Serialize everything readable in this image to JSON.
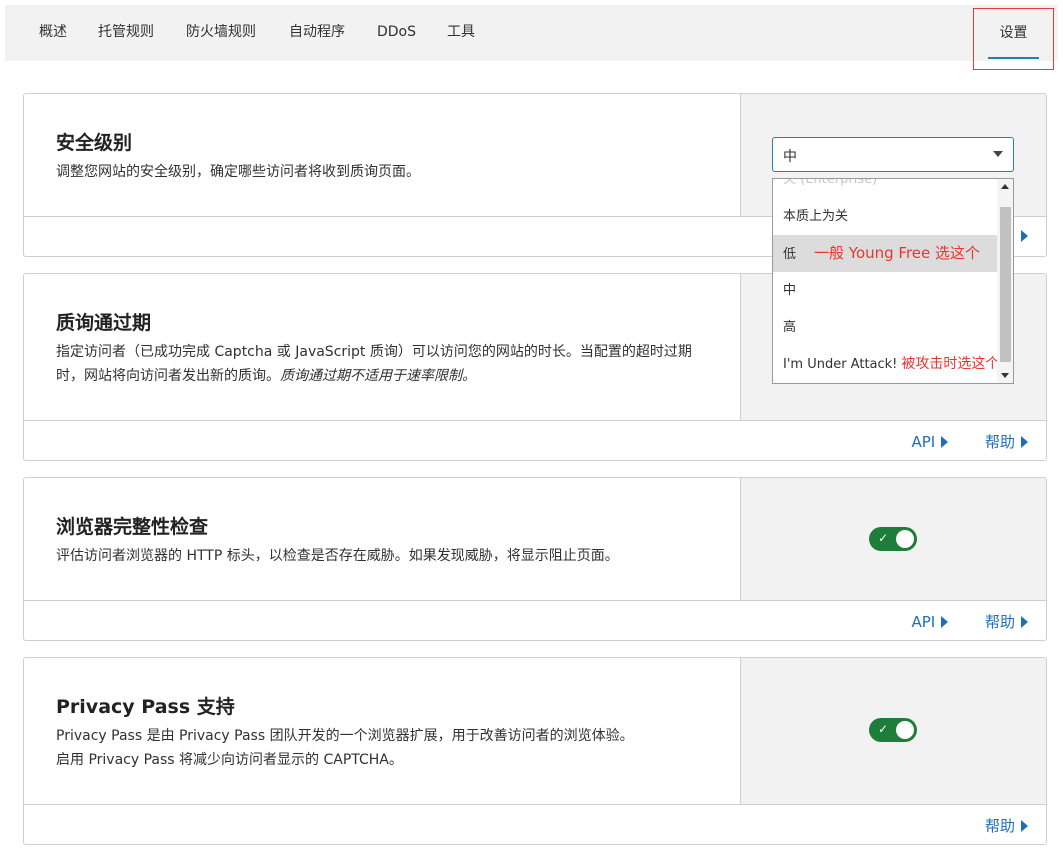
{
  "nav": {
    "tabs": [
      {
        "label": "概述"
      },
      {
        "label": "托管规则"
      },
      {
        "label": "防火墙规则"
      },
      {
        "label": "自动程序"
      },
      {
        "label": "DDoS"
      },
      {
        "label": "工具"
      }
    ],
    "active_tab": "设置"
  },
  "security_level": {
    "title": "安全级别",
    "description": "调整您网站的安全级别，确定哪些访问者将收到质询页面。",
    "selected": "中",
    "options": [
      {
        "label": "关 (Enterprise)",
        "note": ""
      },
      {
        "label": "本质上为关",
        "note": ""
      },
      {
        "label": "低",
        "note": "一般 Young Free 选这个"
      },
      {
        "label": "中",
        "note": ""
      },
      {
        "label": "高",
        "note": ""
      },
      {
        "label": "I'm Under Attack!",
        "note": "被攻击时选这个"
      }
    ],
    "highlighted_option": "低"
  },
  "challenge_passage": {
    "title": "质询通过期",
    "description": "指定访问者（已成功完成 Captcha 或 JavaScript 质询）可以访问您的网站的时长。当配置的超时过期时，网站将向访问者发出新的质询。",
    "description_italic": "质询通过期不适用于速率限制。",
    "api_label": "API",
    "help_label": "帮助"
  },
  "browser_check": {
    "title": "浏览器完整性检查",
    "description": "评估访问者浏览器的 HTTP 标头，以检查是否存在威胁。如果发现威胁，将显示阻止页面。",
    "enabled": true,
    "api_label": "API",
    "help_label": "帮助"
  },
  "privacy_pass": {
    "title": "Privacy Pass 支持",
    "description_line1": "Privacy Pass 是由 Privacy Pass 团队开发的一个浏览器扩展，用于改善访问者的浏览体验。",
    "description_line2": "启用 Privacy Pass 将减少向访问者显示的 CAPTCHA。",
    "enabled": true,
    "help_label": "帮助"
  },
  "colors": {
    "accent": "#2c7cb0",
    "link": "#1f6fb8",
    "toggle_on": "#1e7d3a",
    "annotation": "#e8352f"
  }
}
